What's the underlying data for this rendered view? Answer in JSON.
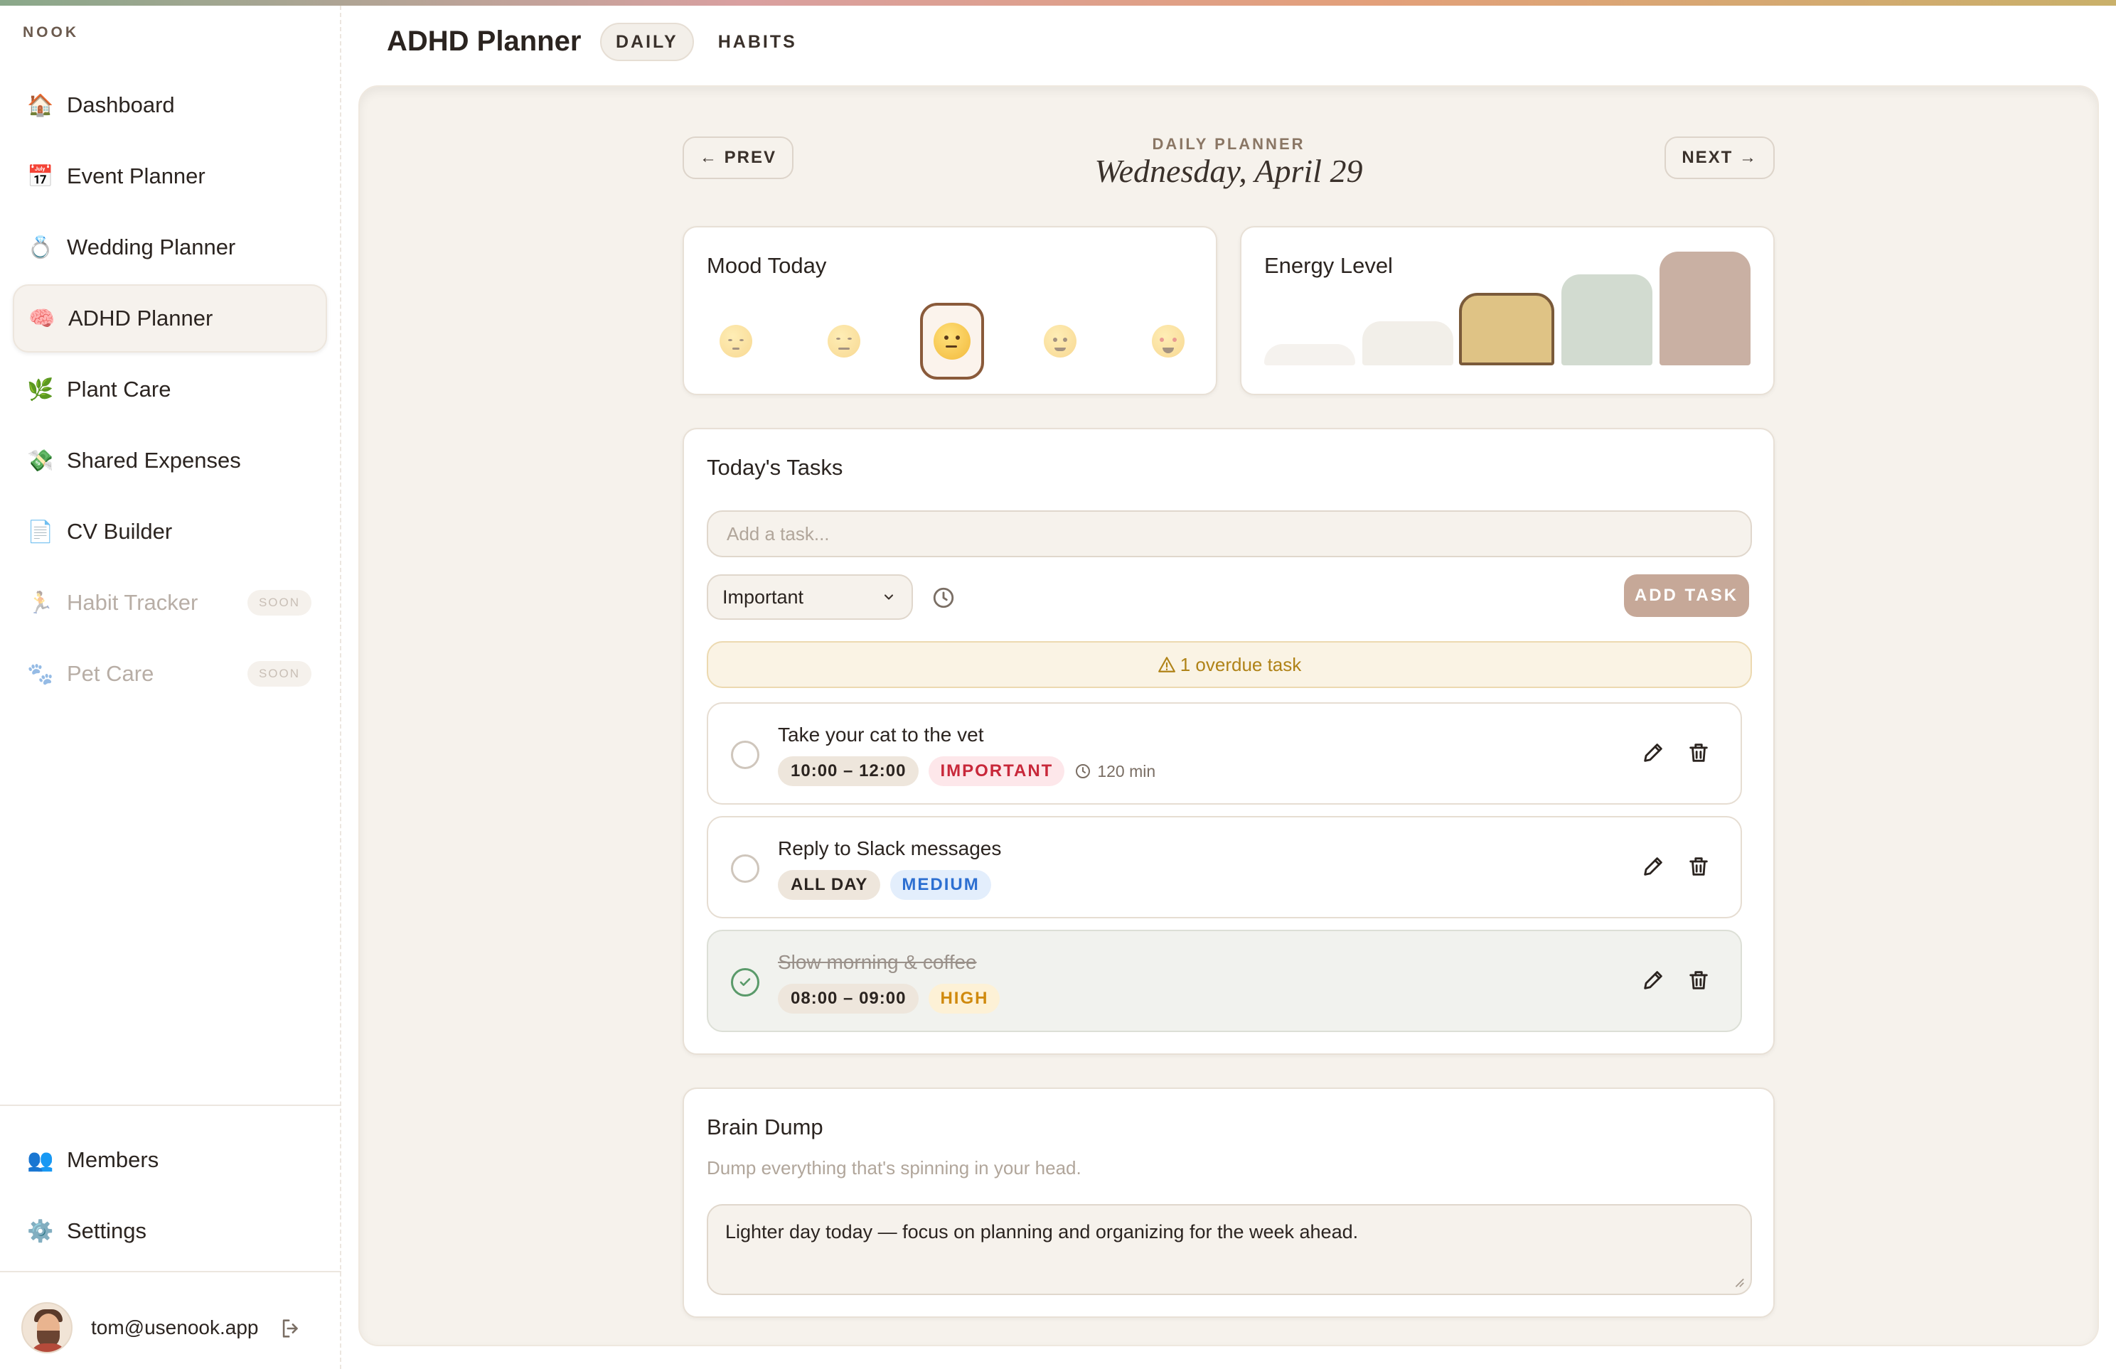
{
  "app": {
    "brand": "NOOK"
  },
  "sidebar": {
    "items": [
      {
        "label": "Dashboard",
        "icon": "house-icon",
        "glyph": "🏠"
      },
      {
        "label": "Event Planner",
        "icon": "calendar-icon",
        "glyph": "📅"
      },
      {
        "label": "Wedding Planner",
        "icon": "ring-icon",
        "glyph": "💍"
      },
      {
        "label": "ADHD Planner",
        "icon": "brain-icon",
        "glyph": "🧠",
        "active": true
      },
      {
        "label": "Plant Care",
        "icon": "herb-icon",
        "glyph": "🌿"
      },
      {
        "label": "Shared Expenses",
        "icon": "money-icon",
        "glyph": "💸"
      },
      {
        "label": "CV Builder",
        "icon": "document-icon",
        "glyph": "📄"
      },
      {
        "label": "Habit Tracker",
        "icon": "runner-icon",
        "glyph": "🏃",
        "badge": "SOON",
        "disabled": true
      },
      {
        "label": "Pet Care",
        "icon": "paw-icon",
        "glyph": "🐾",
        "badge": "SOON",
        "disabled": true
      }
    ],
    "bottom_items": [
      {
        "label": "Members",
        "icon": "people-icon",
        "glyph": "👥"
      },
      {
        "label": "Settings",
        "icon": "gear-icon",
        "glyph": "⚙️"
      }
    ],
    "user_email": "tom@usenook.app"
  },
  "header": {
    "title": "ADHD Planner",
    "tabs": [
      {
        "label": "DAILY",
        "active": true
      },
      {
        "label": "HABITS",
        "active": false
      }
    ]
  },
  "planner": {
    "label": "DAILY PLANNER",
    "date": "Wednesday, April 29",
    "prev_label": "← PREV",
    "next_label": "NEXT →"
  },
  "mood": {
    "title": "Mood Today",
    "options": [
      "sleepy",
      "sad",
      "neutral",
      "slightly-smiling",
      "star-struck"
    ],
    "selected_index": 2
  },
  "energy": {
    "title": "Energy Level",
    "levels": 5,
    "selected_level": 3,
    "colors": [
      "#f5f2ee",
      "#f2efe9",
      "#dfc385",
      "#d2dbd0",
      "#c9b0a3"
    ]
  },
  "tasks": {
    "title": "Today's Tasks",
    "input_placeholder": "Add a task...",
    "priority_selected": "Important",
    "add_label": "ADD TASK",
    "overdue_text": "1 overdue task",
    "items": [
      {
        "title": "Take your cat to the vet",
        "time": "10:00 – 12:00",
        "priority": "IMPORTANT",
        "priority_color": "#c8283a",
        "priority_bg": "#fde7ea",
        "duration": "120 min",
        "done": false
      },
      {
        "title": "Reply to Slack messages",
        "time": "ALL DAY",
        "priority": "MEDIUM",
        "priority_color": "#2d6fd1",
        "priority_bg": "#e3eefc",
        "done": false
      },
      {
        "title": "Slow morning & coffee",
        "time": "08:00 – 09:00",
        "priority": "HIGH",
        "priority_color": "#d08a0e",
        "priority_bg": "#fdf1d6",
        "done": true
      }
    ]
  },
  "brain_dump": {
    "title": "Brain Dump",
    "subtitle": "Dump everything that's spinning in your head.",
    "text": "Lighter day today — focus on planning and organizing for the week ahead."
  }
}
